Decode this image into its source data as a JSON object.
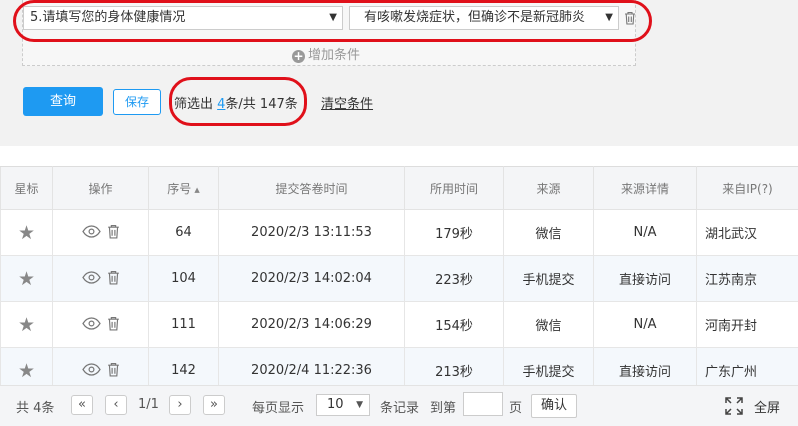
{
  "filter": {
    "question_select": "5.请填写您的身体健康情况",
    "answer_select": "有咳嗽发烧症状，但确诊不是新冠肺炎",
    "add_condition_label": "增加条件"
  },
  "actions": {
    "query_label": "查询",
    "save_label": "保存",
    "result_prefix": "筛选出 ",
    "result_count": "4",
    "result_suffix": "条/共 147条",
    "clear_label": "清空条件"
  },
  "table": {
    "headers": [
      "星标",
      "操作",
      "序号",
      "提交答卷时间",
      "所用时间",
      "来源",
      "来源详情",
      "来自IP(?)"
    ],
    "rows": [
      {
        "seq": "64",
        "time": "2020/2/3 13:11:53",
        "duration": "179秒",
        "source": "微信",
        "detail": "N/A",
        "ip": "湖北武汉"
      },
      {
        "seq": "104",
        "time": "2020/2/3 14:02:04",
        "duration": "223秒",
        "source": "手机提交",
        "detail": "直接访问",
        "ip": "江苏南京"
      },
      {
        "seq": "111",
        "time": "2020/2/3 14:06:29",
        "duration": "154秒",
        "source": "微信",
        "detail": "N/A",
        "ip": "河南开封"
      },
      {
        "seq": "142",
        "time": "2020/2/4 11:22:36",
        "duration": "213秒",
        "source": "手机提交",
        "detail": "直接访问",
        "ip": "广东广州"
      }
    ]
  },
  "pager": {
    "total_label": "共 4条",
    "page_indicator": "1/1",
    "per_page_label": "每页显示",
    "page_size": "10",
    "records_label": "条记录",
    "goto_label": "到第",
    "page_unit": "页",
    "confirm_label": "确认",
    "fullscreen_label": "全屏"
  },
  "icons": {
    "star": "star-icon",
    "view": "eye-icon",
    "delete": "trash-icon",
    "add": "plus-circle-icon",
    "fullscreen": "expand-icon"
  },
  "colors": {
    "accent": "#1e9af2",
    "highlight": "#e0101a"
  }
}
